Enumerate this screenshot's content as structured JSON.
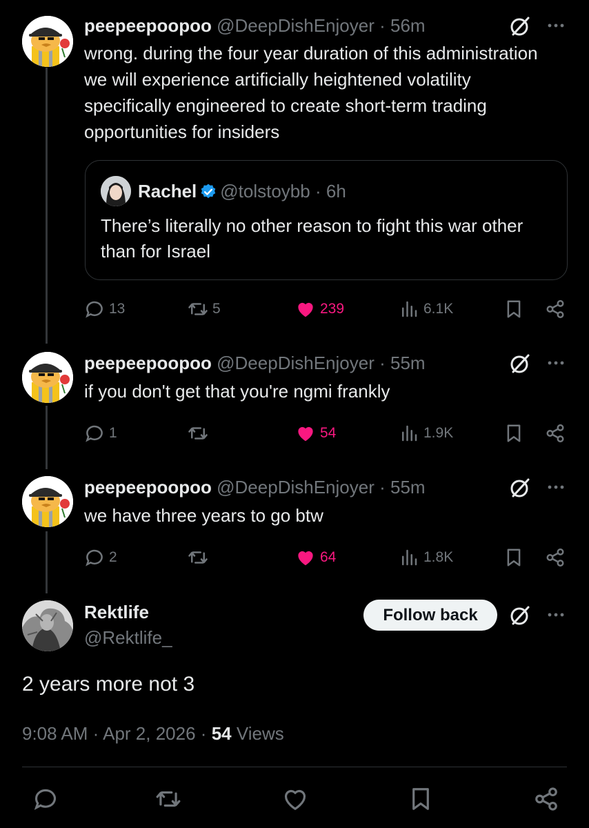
{
  "replies": [
    {
      "display_name": "peepeepoopoo",
      "handle": "@DeepDishEnjoyer",
      "time": "56m",
      "text": "wrong. during the four year duration of this administration we will experience artificially heightened volatility specifically engineered to create short-term trading opportunities for insiders",
      "quote": {
        "display_name": "Rachel",
        "handle": "@tolstoybb",
        "time": "6h",
        "text": "There’s literally no other reason to fight this war other than for Israel"
      },
      "stats": {
        "replies": "13",
        "reposts": "5",
        "likes": "239",
        "views": "6.1K"
      }
    },
    {
      "display_name": "peepeepoopoo",
      "handle": "@DeepDishEnjoyer",
      "time": "55m",
      "text": "if you don't get that you're ngmi frankly",
      "stats": {
        "replies": "1",
        "reposts": "",
        "likes": "54",
        "views": "1.9K"
      }
    },
    {
      "display_name": "peepeepoopoo",
      "handle": "@DeepDishEnjoyer",
      "time": "55m",
      "text": "we have three years to go btw",
      "stats": {
        "replies": "2",
        "reposts": "",
        "likes": "64",
        "views": "1.8K"
      }
    }
  ],
  "main_post": {
    "display_name": "Rektlife",
    "handle": "@Rektlife_",
    "follow_label": "Follow back",
    "text": "2 years more not 3",
    "time": "9:08 AM",
    "date": "Apr 2, 2026",
    "views_count": "54",
    "views_label": "Views"
  },
  "separator": "·",
  "colors": {
    "background": "#000000",
    "text": "#e7e9ea",
    "muted": "#71767b",
    "like": "#f91880",
    "verified": "#1d9bf0",
    "border": "#2f3336"
  },
  "icons": [
    "grok-icon",
    "more-icon",
    "reply-icon",
    "repost-icon",
    "like-icon",
    "views-icon",
    "bookmark-icon",
    "share-icon",
    "verified-icon"
  ]
}
